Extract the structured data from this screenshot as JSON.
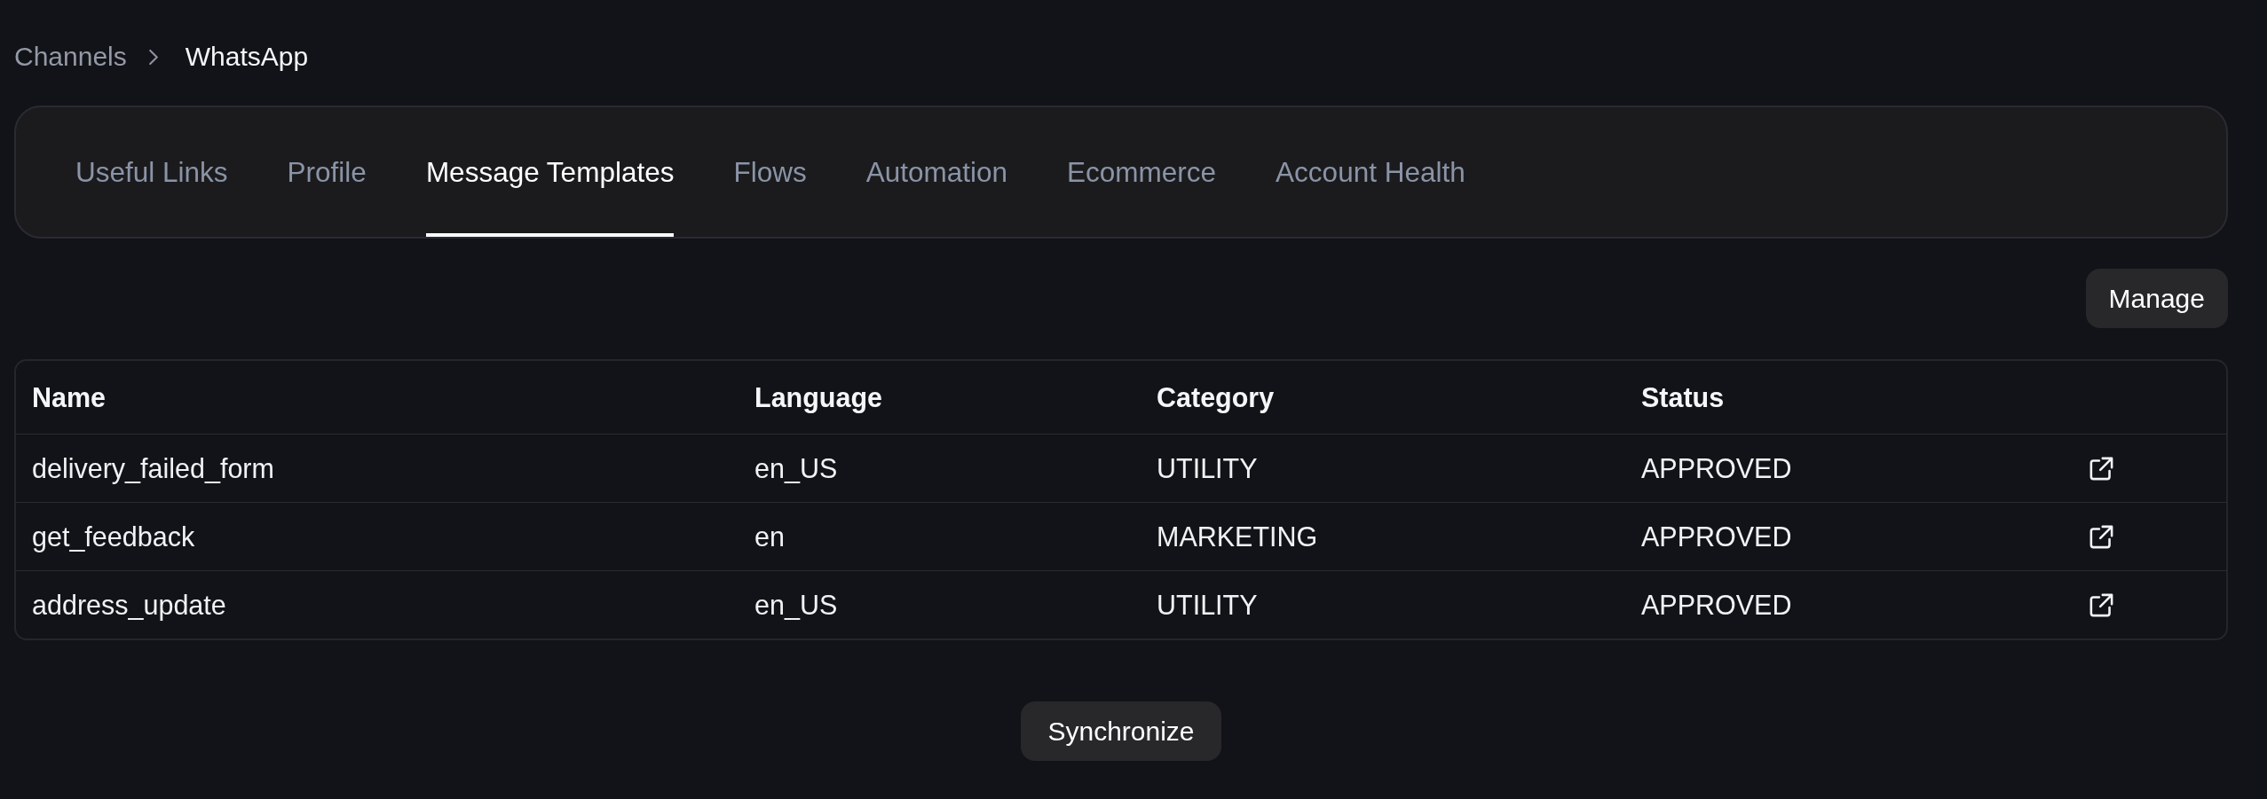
{
  "breadcrumb": [
    {
      "label": "Channels",
      "current": false
    },
    {
      "label": "WhatsApp",
      "current": true
    }
  ],
  "tabs": [
    {
      "label": "Useful Links",
      "selected": false
    },
    {
      "label": "Profile",
      "selected": false
    },
    {
      "label": "Message Templates",
      "selected": true
    },
    {
      "label": "Flows",
      "selected": false
    },
    {
      "label": "Automation",
      "selected": false
    },
    {
      "label": "Ecommerce",
      "selected": false
    },
    {
      "label": "Account Health",
      "selected": false
    }
  ],
  "toolbar": {
    "manage_button": "Manage"
  },
  "table": {
    "columns": [
      "Name",
      "Language",
      "Category",
      "Status"
    ],
    "rows": [
      {
        "name": "delivery_failed_form",
        "language": "en_US",
        "category": "UTILITY",
        "status": "APPROVED"
      },
      {
        "name": "get_feedback",
        "language": "en",
        "category": "MARKETING",
        "status": "APPROVED"
      },
      {
        "name": "address_update",
        "language": "en_US",
        "category": "UTILITY",
        "status": "APPROVED"
      }
    ]
  },
  "footer": {
    "synchronize_button": "Synchronize"
  }
}
